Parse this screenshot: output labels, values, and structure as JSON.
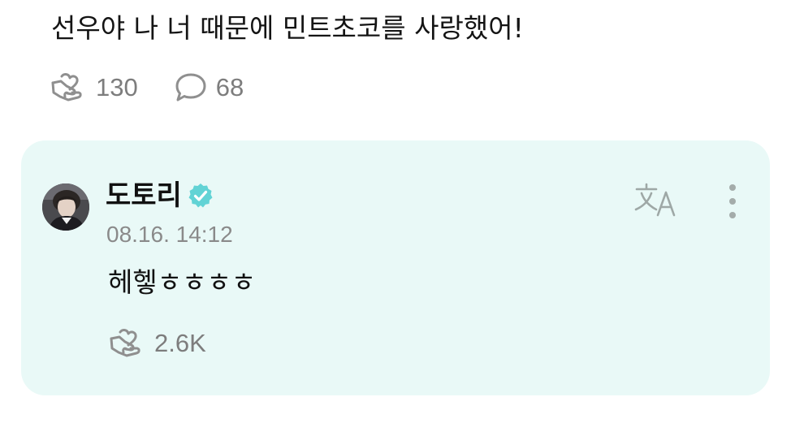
{
  "post": {
    "text": "선우야 나 너 때문에 민트초코를 사랑했어!",
    "likes_count": "130",
    "comments_count": "68"
  },
  "reply": {
    "author": {
      "name": "도토리",
      "verified": true
    },
    "timestamp": "08.16. 14:12",
    "text": "헤헿ㅎㅎㅎㅎ",
    "likes_count": "2.6K"
  },
  "icons": {
    "like": "heart-hand-icon",
    "comment": "speech-bubble-icon",
    "verified": "verified-badge-icon",
    "translate": "translate-icon",
    "more": "more-vertical-icon"
  },
  "colors": {
    "card_background": "#e9f9f7",
    "verified_badge": "#62d3d5",
    "muted_text": "#7d7d7d",
    "icon_gray": "#8f8f8f"
  }
}
